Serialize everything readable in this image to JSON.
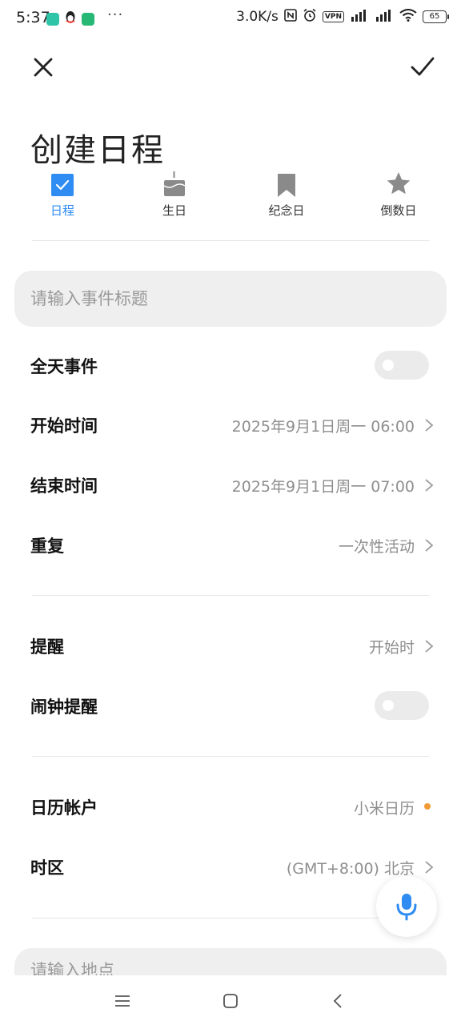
{
  "status_bar": {
    "time": "5:37",
    "more": "···",
    "net_speed": "3.0K/s",
    "vpn": "VPN",
    "battery": "65"
  },
  "header": {
    "title": "创建日程"
  },
  "event_types": [
    {
      "label": "日程",
      "icon": "checkbox-icon",
      "active": true
    },
    {
      "label": "生日",
      "icon": "cake-icon",
      "active": false
    },
    {
      "label": "纪念日",
      "icon": "bookmark-icon",
      "active": false
    },
    {
      "label": "倒数日",
      "icon": "star-icon",
      "active": false
    }
  ],
  "form": {
    "title_placeholder": "请输入事件标题",
    "all_day": {
      "label": "全天事件",
      "on": false
    },
    "start_time": {
      "label": "开始时间",
      "value": "2025年9月1日周一 06:00"
    },
    "end_time": {
      "label": "结束时间",
      "value": "2025年9月1日周一 07:00"
    },
    "repeat": {
      "label": "重复",
      "value": "一次性活动"
    },
    "reminder": {
      "label": "提醒",
      "value": "开始时"
    },
    "alarm_reminder": {
      "label": "闹钟提醒",
      "on": false
    },
    "calendar_account": {
      "label": "日历帐户",
      "value": "小米日历"
    },
    "timezone": {
      "label": "时区",
      "value": "(GMT+8:00) 北京"
    },
    "location_placeholder": "请输入地点"
  },
  "colors": {
    "accent": "#2f8cf2",
    "account_dot": "#f29a35",
    "icon_gray": "#8a8a8a"
  }
}
